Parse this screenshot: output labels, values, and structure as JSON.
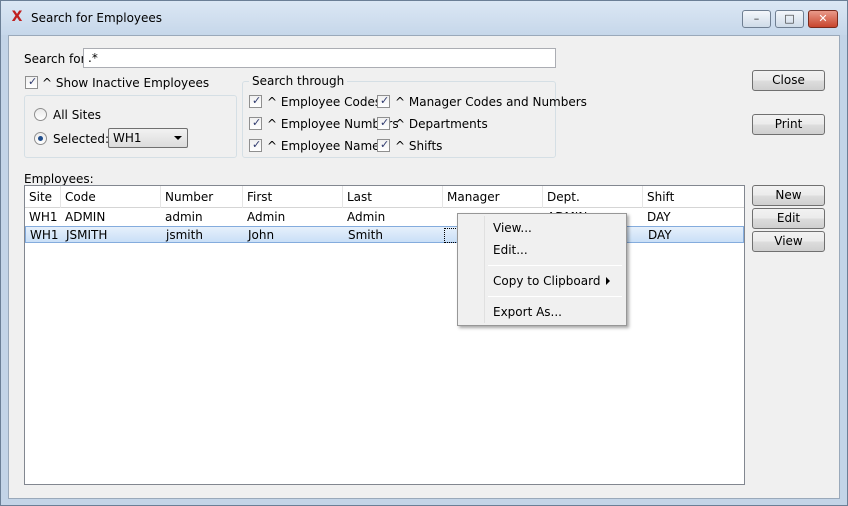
{
  "window": {
    "title": "Search for Employees",
    "minimize_glyph": "–",
    "maximize_glyph": "□",
    "close_glyph": "✕"
  },
  "search": {
    "label": "Search for:",
    "value": ".*"
  },
  "show_inactive": {
    "label": "^ Show Inactive Employees",
    "checked": true
  },
  "sites": {
    "all_sites_label": "All Sites",
    "selected_label": "Selected:",
    "selected_checked": true,
    "selected_value": "WH1"
  },
  "search_through": {
    "title": "Search through",
    "employee_codes": "^ Employee Codes",
    "employee_numbers": "^ Employee Numbers",
    "employee_name": "^ Employee Name",
    "manager_codes": "^ Manager Codes and Numbers",
    "departments": "^ Departments",
    "shifts": "^ Shifts"
  },
  "buttons": {
    "close": "Close",
    "print": "Print",
    "new": "New",
    "edit": "Edit",
    "view": "View"
  },
  "employees": {
    "label": "Employees:",
    "columns": [
      "Site",
      "Code",
      "Number",
      "First",
      "Last",
      "Manager",
      "Dept.",
      "Shift"
    ],
    "rows": [
      {
        "site": "WH1",
        "code": "ADMIN",
        "number": "admin",
        "first": "Admin",
        "last": "Admin",
        "manager": "",
        "dept": "ADMIN",
        "shift": "DAY",
        "selected": false
      },
      {
        "site": "WH1",
        "code": "JSMITH",
        "number": "jsmith",
        "first": "John",
        "last": "Smith",
        "manager": "",
        "dept": "",
        "shift": "DAY",
        "selected": true
      }
    ]
  },
  "context_menu": {
    "view": "View...",
    "edit": "Edit...",
    "copy": "Copy to Clipboard",
    "export": "Export As..."
  },
  "icons": {
    "app": "x-logo-icon",
    "check": "checkmark-icon",
    "dropdown": "chevron-down-icon",
    "submenu": "chevron-right-icon"
  }
}
